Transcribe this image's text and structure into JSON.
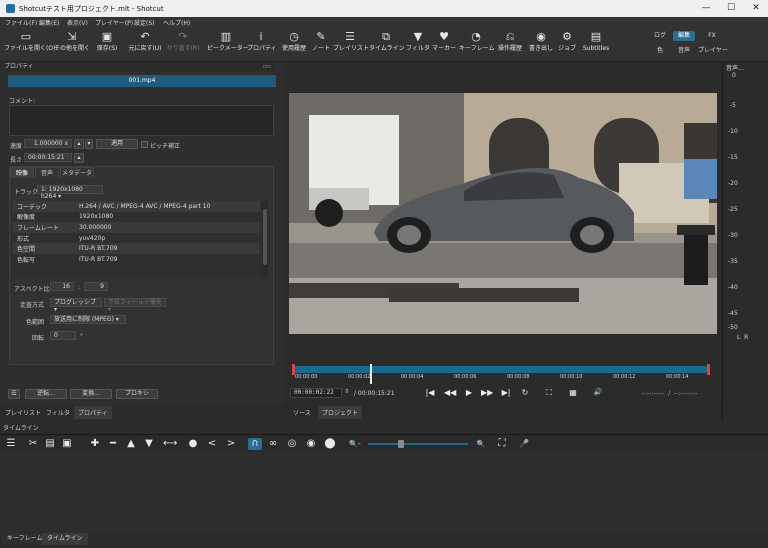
{
  "window": {
    "title": "Shotcutテスト用プロジェクト.mlt - Shotcut",
    "minimize": "—",
    "maximize": "☐",
    "close": "✕"
  },
  "menubar": [
    "ファイル(F)",
    "編集(E)",
    "表示(V)",
    "プレイヤー(P)",
    "設定(S)",
    "ヘルプ(H)"
  ],
  "toolbar": {
    "items": [
      {
        "icon": "▭",
        "label": "ファイルを開く(O)"
      },
      {
        "icon": "⇲",
        "label": "その他を開く"
      },
      {
        "icon": "▣",
        "label": "保存(S)"
      },
      {
        "icon": "↶",
        "label": "元に戻す(U)"
      },
      {
        "icon": "↷",
        "label": "やり直す(R)"
      },
      {
        "icon": "▥",
        "label": "ピークメーター"
      },
      {
        "icon": "i",
        "label": "プロパティ"
      },
      {
        "icon": "◷",
        "label": "使用履歴"
      },
      {
        "icon": "✎",
        "label": "ノート"
      },
      {
        "icon": "☰",
        "label": "プレイリスト"
      },
      {
        "icon": "⧉",
        "label": "タイムライン"
      },
      {
        "icon": "▼",
        "label": "フィルタ"
      },
      {
        "icon": "♥",
        "label": "マーカー"
      },
      {
        "icon": "◔",
        "label": "キーフレーム"
      },
      {
        "icon": "⎌",
        "label": "操作履歴"
      },
      {
        "icon": "◉",
        "label": "書き出し"
      },
      {
        "icon": "⚙",
        "label": "ジョブ"
      },
      {
        "icon": "▤",
        "label": "Subtitles"
      }
    ],
    "layouts": {
      "log": "ログ",
      "edit": "編集",
      "fx": "FX",
      "color": "色",
      "audio": "音声",
      "player": "プレイヤー"
    }
  },
  "properties": {
    "panel_title": "プロパティ",
    "clip_name": "001.mp4",
    "comment_label": "コメント:",
    "speed_label": "速度",
    "speed_value": "1.000000 x",
    "apply_button": "適用",
    "pitch_label": "ピッチ補正",
    "length_label": "長さ",
    "length_value": "00:00:15:21",
    "tabs": [
      "映像",
      "音声",
      "メタデータ"
    ],
    "track_label": "トラック",
    "track_value": "1: 1920x1080 h264",
    "metadata": [
      [
        "コーデック",
        "H.264 / AVC / MPEG-4 AVC / MPEG-4 part 10"
      ],
      [
        "解像度",
        "1920x1080"
      ],
      [
        "フレームレート",
        "30.000000"
      ],
      [
        "形式",
        "yuv420p"
      ],
      [
        "色空間",
        "ITU-R BT.709"
      ],
      [
        "色転写",
        "ITU-R BT.709"
      ]
    ],
    "aspect_label": "アスペクト比",
    "aspect_w": "16",
    "aspect_h": "9",
    "scan_label": "走査方式",
    "scan_value": "プログレッシブ",
    "field_value": "下位フィールド優先",
    "range_label": "色範囲",
    "range_value": "放送用に制限 (MPEG)",
    "rotation_label": "回転",
    "rotation_value": "0",
    "rotation_unit": "°",
    "buttons": {
      "menu": "☰",
      "reverse": "逆転...",
      "convert": "変換...",
      "proxy": "プロキシ"
    }
  },
  "left_tabs": [
    "プレイリスト",
    "フィルタ",
    "プロパティ"
  ],
  "audio_meter": {
    "title": "音声...",
    "ticks": [
      "0",
      "-5",
      "-10",
      "-15",
      "-20",
      "-25",
      "-30",
      "-35",
      "-40",
      "-45",
      "-50"
    ],
    "channels": "L  R"
  },
  "player": {
    "ruler_labels": [
      "00:00:00",
      "00:00:02",
      "00:00:04",
      "00:00:06",
      "00:00:08",
      "00:00:10",
      "00:00:12",
      "00:00:14"
    ],
    "current_time": "00:00:02:22",
    "duration": "/ 00:00:15:21",
    "in_out": "--:--:--:--  /  --:--:--:--",
    "tabs": [
      "ソース",
      "プロジェクト"
    ],
    "position": 0.186
  },
  "transport_icons": [
    "|◀",
    "◀◀",
    "▶",
    "▶▶",
    "▶|",
    "↻",
    "⛶",
    "▦",
    "🔊"
  ],
  "timeline": {
    "title": "タイムライン",
    "icons": [
      "☰",
      "✂",
      "▤",
      "▣",
      "✚",
      "━",
      "▲",
      "▼",
      "⟷",
      "●",
      "<",
      ">",
      "∩",
      "∞",
      "◎",
      "◉",
      "⬤",
      "🔍-",
      "🔍+",
      "⛶",
      "🎤"
    ],
    "bottom_tabs": [
      "キーフレーム",
      "タイムライン"
    ]
  },
  "colors": {
    "accent": "#2a6e93",
    "clip_header": "#1e5b7e",
    "ruler": "#1b6991",
    "playhead": "#e04040"
  }
}
